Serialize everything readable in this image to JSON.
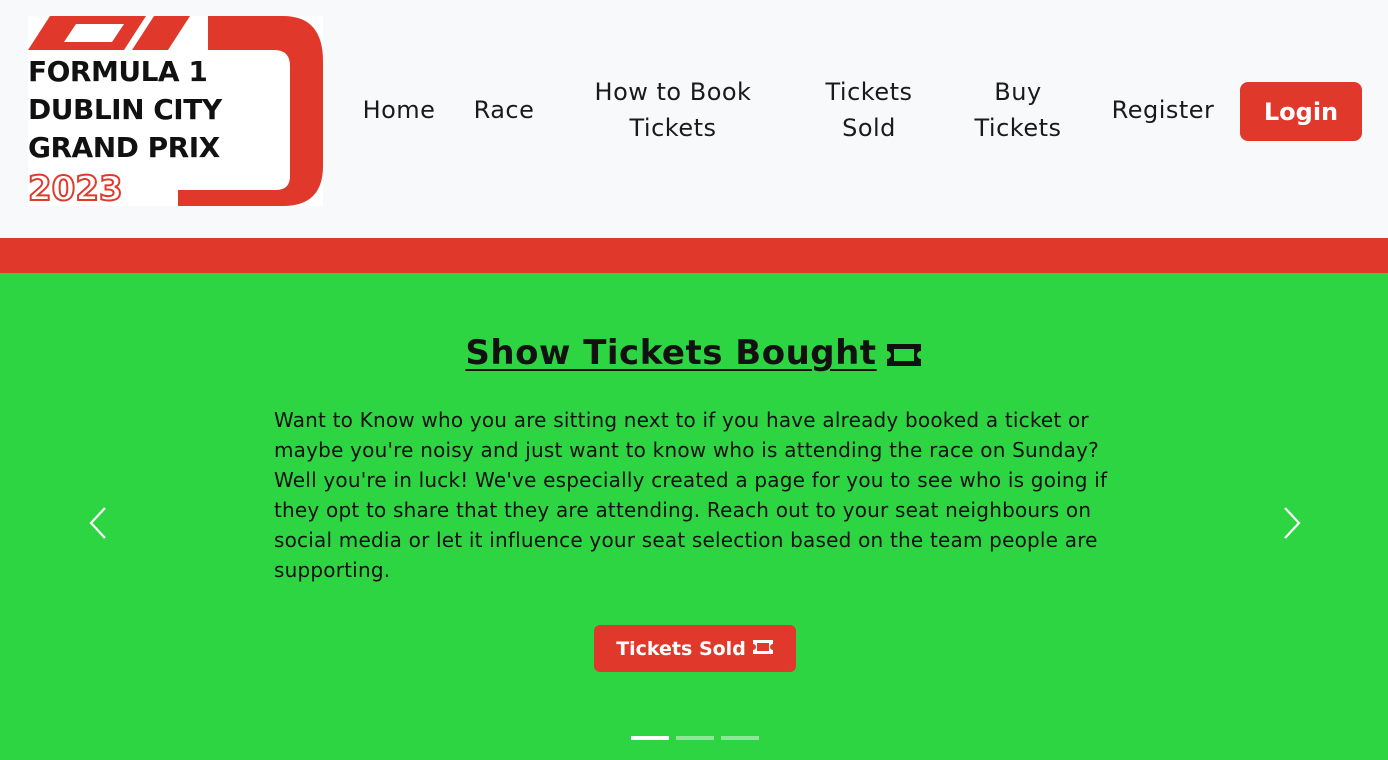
{
  "logo": {
    "line1": "FORMULA 1",
    "line2": "DUBLIN CITY",
    "line3": "GRAND PRIX",
    "year": "2023"
  },
  "nav": {
    "home": "Home",
    "race": "Race",
    "how_to_book": "How to Book Tickets",
    "tickets_sold": "Tickets Sold",
    "buy_tickets": "Buy Tickets",
    "register": "Register",
    "login": "Login"
  },
  "carousel": {
    "title": "Show Tickets Bought",
    "title_icon": "ticket-icon",
    "text": "Want to Know who you are sitting next to if you have already booked a ticket or maybe you're noisy and just want to know who is attending the race on Sunday? Well you're in luck! We've especially created a page for you to see who is going if they opt to share that they are attending. Reach out to your seat neighbours on social media or let it influence your seat selection based on the team people are supporting.",
    "button_label": "Tickets Sold",
    "button_icon": "ticket-icon",
    "active_slide": 1,
    "slide_count": 3
  },
  "colors": {
    "brand_red": "#e0392b",
    "hero_green": "#2ed543",
    "navbar_bg": "#f8f9fa"
  }
}
